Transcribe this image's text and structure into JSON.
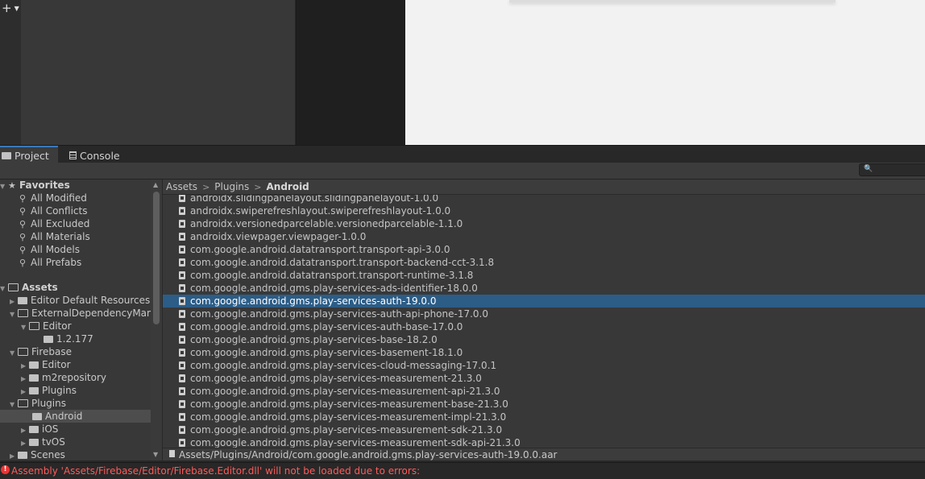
{
  "tabs": [
    {
      "label": "Project",
      "icon": "folder-icon"
    },
    {
      "label": "Console",
      "icon": "console-icon"
    }
  ],
  "toolbar": {
    "add_label": "+",
    "search_placeholder": ""
  },
  "favorites": {
    "header": "Favorites",
    "items": [
      "All Modified",
      "All Conflicts",
      "All Excluded",
      "All Materials",
      "All Models",
      "All Prefabs"
    ]
  },
  "assets_tree": {
    "header": "Assets",
    "items": [
      {
        "label": "Editor Default Resources",
        "depth": 1,
        "expanded": false
      },
      {
        "label": "ExternalDependencyMana",
        "depth": 1,
        "expanded": true
      },
      {
        "label": "Editor",
        "depth": 2,
        "expanded": true
      },
      {
        "label": "1.2.177",
        "depth": 3,
        "expanded": false
      },
      {
        "label": "Firebase",
        "depth": 1,
        "expanded": true
      },
      {
        "label": "Editor",
        "depth": 2,
        "expanded": false
      },
      {
        "label": "m2repository",
        "depth": 2,
        "expanded": false
      },
      {
        "label": "Plugins",
        "depth": 2,
        "expanded": false
      },
      {
        "label": "Plugins",
        "depth": 1,
        "expanded": true
      },
      {
        "label": "Android",
        "depth": 2,
        "expanded": false,
        "selected": true
      },
      {
        "label": "iOS",
        "depth": 2,
        "expanded": false
      },
      {
        "label": "tvOS",
        "depth": 2,
        "expanded": false
      },
      {
        "label": "Scenes",
        "depth": 1,
        "expanded": false
      }
    ]
  },
  "breadcrumb": [
    "Assets",
    "Plugins",
    "Android"
  ],
  "files": [
    "androidx.slidingpanelayout.slidingpanelayout-1.0.0",
    "androidx.swiperefreshlayout.swiperefreshlayout-1.0.0",
    "androidx.versionedparcelable.versionedparcelable-1.1.0",
    "androidx.viewpager.viewpager-1.0.0",
    "com.google.android.datatransport.transport-api-3.0.0",
    "com.google.android.datatransport.transport-backend-cct-3.1.8",
    "com.google.android.datatransport.transport-runtime-3.1.8",
    "com.google.android.gms.play-services-ads-identifier-18.0.0",
    "com.google.android.gms.play-services-auth-19.0.0",
    "com.google.android.gms.play-services-auth-api-phone-17.0.0",
    "com.google.android.gms.play-services-auth-base-17.0.0",
    "com.google.android.gms.play-services-base-18.2.0",
    "com.google.android.gms.play-services-basement-18.1.0",
    "com.google.android.gms.play-services-cloud-messaging-17.0.1",
    "com.google.android.gms.play-services-measurement-21.3.0",
    "com.google.android.gms.play-services-measurement-api-21.3.0",
    "com.google.android.gms.play-services-measurement-base-21.3.0",
    "com.google.android.gms.play-services-measurement-impl-21.3.0",
    "com.google.android.gms.play-services-measurement-sdk-21.3.0",
    "com.google.android.gms.play-services-measurement-sdk-api-21.3.0"
  ],
  "selected_file_index": 8,
  "selected_path": "Assets/Plugins/Android/com.google.android.gms.play-services-auth-19.0.0.aar",
  "status": {
    "error_text": "Assembly 'Assets/Firebase/Editor/Firebase.Editor.dll' will not be loaded due to errors:"
  },
  "colors": {
    "selection": "#2c5d87",
    "error": "#ff5a5a",
    "tab_accent": "#3a79bb"
  }
}
